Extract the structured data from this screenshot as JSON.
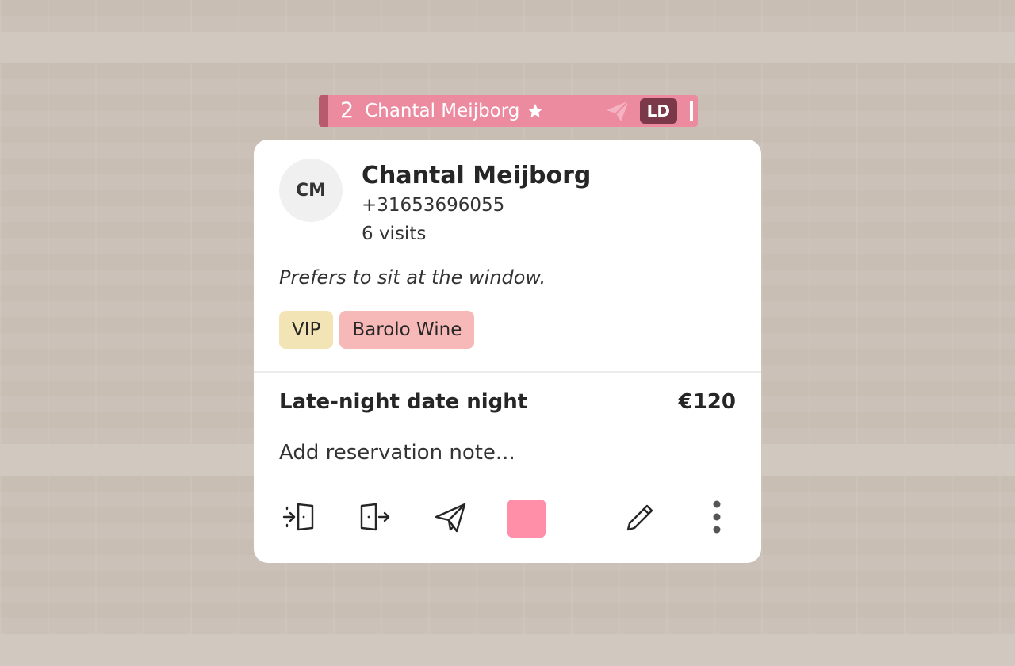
{
  "timeline_bar": {
    "table_number": "2",
    "guest_name": "Chantal Meijborg",
    "badge": "LD",
    "icons": [
      "star-icon",
      "paper-plane-icon"
    ],
    "color": "#ec8aa0"
  },
  "guest": {
    "initials": "CM",
    "name": "Chantal Meijborg",
    "phone": "+31653696055",
    "visits": "6 visits",
    "note": "Prefers to sit at the window.",
    "tags": [
      {
        "label": "VIP",
        "color": "#f3e4b5"
      },
      {
        "label": "Barolo Wine",
        "color": "#f7b9b7"
      }
    ]
  },
  "reservation": {
    "title": "Late-night date night",
    "price": "€120",
    "note_placeholder": "Add reservation note..."
  },
  "actions": {
    "icons": [
      "check-in-icon",
      "check-out-icon",
      "paper-plane-icon",
      "color-swatch",
      "pencil-icon",
      "more-vertical-icon"
    ],
    "swatch_color": "#ff8fa8"
  }
}
